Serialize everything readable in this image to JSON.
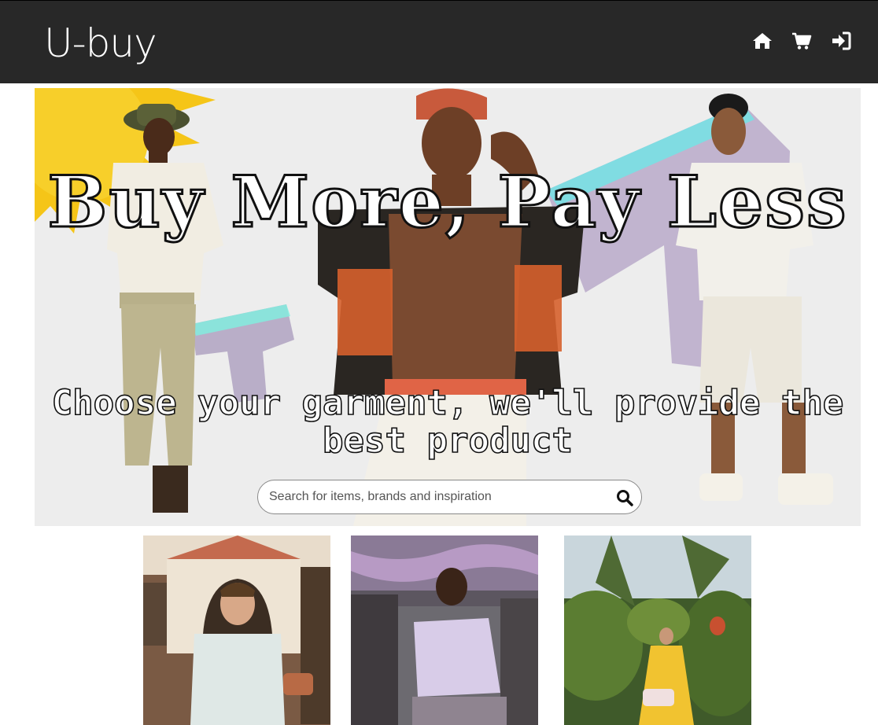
{
  "brand": {
    "name": "U-buy"
  },
  "nav": {
    "icons": [
      "home-icon",
      "cart-icon",
      "sign-in-icon"
    ]
  },
  "hero": {
    "title": "Buy More, Pay Less",
    "subtitle": "Choose your garment, we'll provide the best product"
  },
  "search": {
    "placeholder": "Search for items, brands and inspiration",
    "value": "",
    "icon": "search-icon"
  },
  "colors": {
    "navbar_bg": "#282828",
    "text_light": "#ffffff"
  },
  "products": [
    {
      "icon": "product-photo-man-white-tee"
    },
    {
      "icon": "product-photo-man-lilac-shirt"
    },
    {
      "icon": "product-photo-woman-yellow-dress"
    }
  ]
}
